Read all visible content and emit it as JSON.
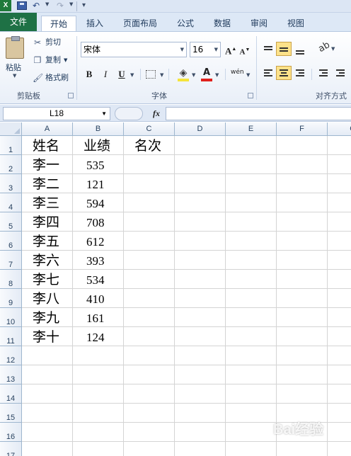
{
  "app": {
    "title_icon": "excel-logo-icon"
  },
  "tabs": [
    {
      "label": "文件"
    },
    {
      "label": "开始"
    },
    {
      "label": "插入"
    },
    {
      "label": "页面布局"
    },
    {
      "label": "公式"
    },
    {
      "label": "数据"
    },
    {
      "label": "审阅"
    },
    {
      "label": "视图"
    }
  ],
  "ribbon": {
    "clipboard": {
      "paste_label": "粘贴",
      "cut_label": "剪切",
      "copy_label": "复制",
      "format_painter_label": "格式刷",
      "group_label": "剪贴板"
    },
    "font": {
      "font_name": "宋体",
      "font_size": "16",
      "grow_label": "A",
      "shrink_label": "A",
      "bold_label": "B",
      "italic_label": "I",
      "underline_label": "U",
      "font_color_label": "A",
      "phonetic_label": "wén",
      "group_label": "字体"
    },
    "alignment": {
      "group_label": "对齐方式"
    }
  },
  "formula_bar": {
    "name_box": "L18",
    "fx_label": "fx",
    "formula": ""
  },
  "sheet": {
    "columns": [
      "A",
      "B",
      "C",
      "D",
      "E",
      "F",
      "G"
    ],
    "rows": [
      "1",
      "2",
      "3",
      "4",
      "5",
      "6",
      "7",
      "8",
      "9",
      "10",
      "11",
      "12",
      "13",
      "14",
      "15",
      "16",
      "17"
    ],
    "header": [
      "姓名",
      "业绩",
      "名次"
    ],
    "data": [
      [
        "李一",
        "535"
      ],
      [
        "李二",
        "121"
      ],
      [
        "李三",
        "594"
      ],
      [
        "李四",
        "708"
      ],
      [
        "李五",
        "612"
      ],
      [
        "李六",
        "393"
      ],
      [
        "李七",
        "534"
      ],
      [
        "李八",
        "410"
      ],
      [
        "李九",
        "161"
      ],
      [
        "李十",
        "124"
      ]
    ]
  },
  "watermark": "Bai经验",
  "colors": {
    "file_tab": "#1e7145",
    "ribbon_bg": "#e9eff8",
    "selected_button": "#fde28a",
    "gridline": "#d4d4d4",
    "header_text": "#27415f"
  }
}
